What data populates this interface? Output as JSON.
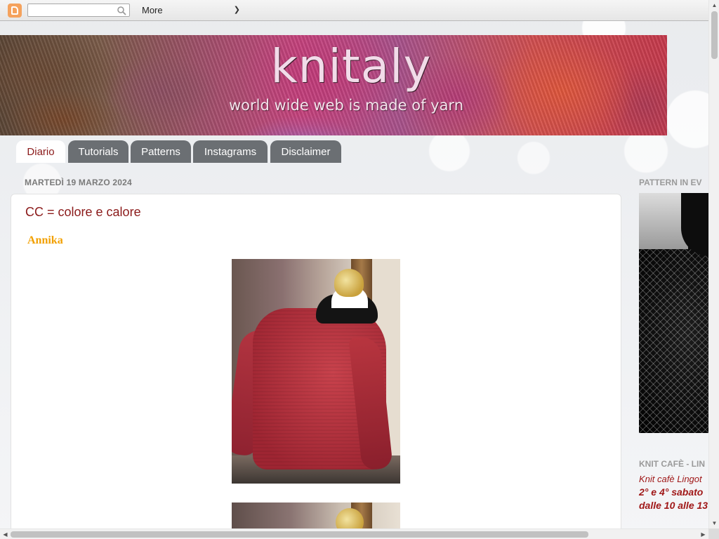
{
  "navbar": {
    "search_placeholder": "",
    "more_label": "More"
  },
  "header": {
    "title": "knitaly",
    "subtitle": "world wide web is made of yarn"
  },
  "tabs": [
    {
      "label": "Diario",
      "active": true
    },
    {
      "label": "Tutorials",
      "active": false
    },
    {
      "label": "Patterns",
      "active": false
    },
    {
      "label": "Instagrams",
      "active": false
    },
    {
      "label": "Disclaimer",
      "active": false
    }
  ],
  "post": {
    "date": "MARTEDÌ 19 MARZO 2024",
    "title": "CC = colore e calore",
    "subtitle": "Annika"
  },
  "sidebar": {
    "pattern_title": "PATTERN IN EV",
    "knit_title": "KNIT CAFÈ - LIN",
    "knit_line1": "Knit cafè Lingot",
    "knit_line2": "2° e 4° sabato",
    "knit_line3": "dalle 10 alle 13"
  },
  "colors": {
    "accent": "#8b1a1a",
    "tab_bg": "#6b6f73",
    "subtitle_orange": "#f2a000",
    "sidebar_red": "#a01818"
  }
}
